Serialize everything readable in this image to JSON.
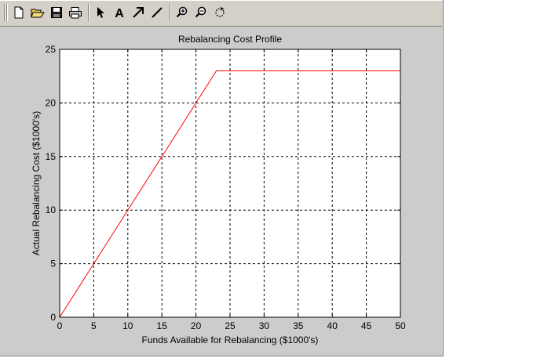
{
  "toolbar": {
    "icons": [
      "new-file-icon",
      "open-folder-icon",
      "save-icon",
      "print-icon",
      "pointer-icon",
      "insert-text-icon",
      "insert-arrow-icon",
      "insert-line-icon",
      "zoom-in-icon",
      "zoom-out-icon",
      "rotate-icon"
    ],
    "text_tool_glyph": "A"
  },
  "chart_data": {
    "type": "line",
    "title": "Rebalancing Cost Profile",
    "xlabel": "Funds Available for Rebalancing ($1000's)",
    "ylabel": "Actual Rebalancing Cost ($1000's)",
    "xlim": [
      0,
      50
    ],
    "ylim": [
      0,
      25
    ],
    "xticks": [
      0,
      5,
      10,
      15,
      20,
      25,
      30,
      35,
      40,
      45,
      50
    ],
    "yticks": [
      0,
      5,
      10,
      15,
      20,
      25
    ],
    "grid": true,
    "series": [
      {
        "color": "#ff0000",
        "x": [
          0,
          23,
          50
        ],
        "y": [
          0,
          23,
          23
        ]
      }
    ]
  }
}
